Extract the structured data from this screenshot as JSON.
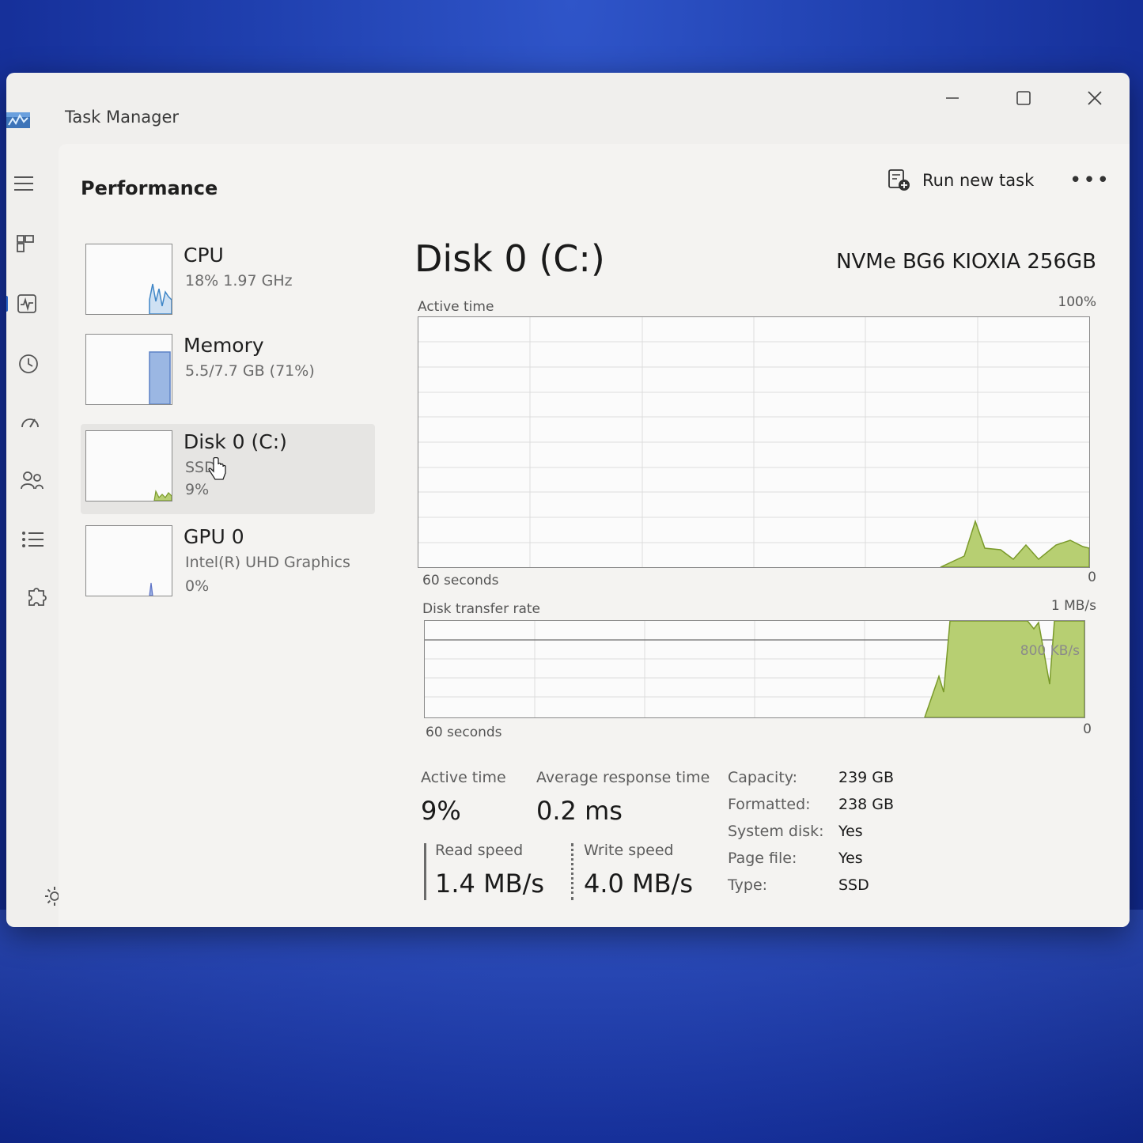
{
  "window": {
    "title": "Task Manager"
  },
  "header": {
    "page_title": "Performance",
    "run_task_label": "Run new task",
    "more_label": "•••"
  },
  "nav": {
    "items": [
      "menu",
      "processes",
      "performance",
      "app-history",
      "startup-apps",
      "users",
      "details",
      "services"
    ]
  },
  "devices": [
    {
      "name": "CPU",
      "sub": "18% 1.97 GHz",
      "sub2": ""
    },
    {
      "name": "Memory",
      "sub": "5.5/7.7 GB (71%)",
      "sub2": ""
    },
    {
      "name": "Disk 0 (C:)",
      "sub": "SSD",
      "sub2": "9%"
    },
    {
      "name": "GPU 0",
      "sub": "Intel(R) UHD Graphics",
      "sub2": "0%"
    }
  ],
  "detail": {
    "title": "Disk 0 (C:)",
    "model": "NVMe BG6 KIOXIA 256GB",
    "active_time_label": "Active time",
    "active_time_max": "100%",
    "time_span": "60 seconds",
    "zero": "0",
    "transfer_label": "Disk transfer rate",
    "transfer_max": "1 MB/s",
    "transfer_mid": "800 KB/s"
  },
  "stats": {
    "active_time_label": "Active time",
    "active_time_value": "9%",
    "avg_response_label": "Average response time",
    "avg_response_value": "0.2 ms",
    "read_label": "Read speed",
    "read_value": "1.4 MB/s",
    "write_label": "Write speed",
    "write_value": "4.0 MB/s",
    "props": [
      {
        "label": "Capacity:",
        "value": "239 GB"
      },
      {
        "label": "Formatted:",
        "value": "238 GB"
      },
      {
        "label": "System disk:",
        "value": "Yes"
      },
      {
        "label": "Page file:",
        "value": "Yes"
      },
      {
        "label": "Type:",
        "value": "SSD"
      }
    ]
  },
  "colors": {
    "disk_fill": "#b7cf72",
    "disk_line": "#7a9a2a",
    "cpu_line": "#3f86c7",
    "memory_fill": "#9bb7e3"
  }
}
